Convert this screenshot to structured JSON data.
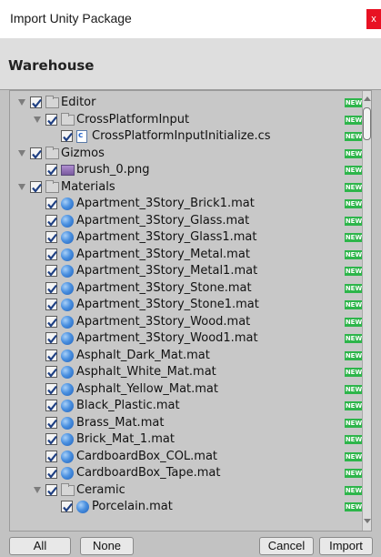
{
  "window": {
    "title": "Import Unity Package",
    "close_glyph": "x"
  },
  "package": {
    "name": "Warehouse"
  },
  "tree": {
    "badge_label": "NEW",
    "items": [
      {
        "label": "Editor",
        "type": "folder",
        "depth": 0,
        "expanded": true,
        "checked": true
      },
      {
        "label": "CrossPlatformInput",
        "type": "folder",
        "depth": 1,
        "expanded": true,
        "checked": true
      },
      {
        "label": "CrossPlatformInputInitialize.cs",
        "type": "script",
        "depth": 2,
        "checked": true
      },
      {
        "label": "Gizmos",
        "type": "folder",
        "depth": 0,
        "expanded": true,
        "checked": true
      },
      {
        "label": "brush_0.png",
        "type": "image",
        "depth": 1,
        "checked": true
      },
      {
        "label": "Materials",
        "type": "folder",
        "depth": 0,
        "expanded": true,
        "checked": true
      },
      {
        "label": "Apartment_3Story_Brick1.mat",
        "type": "material",
        "depth": 1,
        "checked": true
      },
      {
        "label": "Apartment_3Story_Glass.mat",
        "type": "material",
        "depth": 1,
        "checked": true
      },
      {
        "label": "Apartment_3Story_Glass1.mat",
        "type": "material",
        "depth": 1,
        "checked": true
      },
      {
        "label": "Apartment_3Story_Metal.mat",
        "type": "material",
        "depth": 1,
        "checked": true
      },
      {
        "label": "Apartment_3Story_Metal1.mat",
        "type": "material",
        "depth": 1,
        "checked": true
      },
      {
        "label": "Apartment_3Story_Stone.mat",
        "type": "material",
        "depth": 1,
        "checked": true
      },
      {
        "label": "Apartment_3Story_Stone1.mat",
        "type": "material",
        "depth": 1,
        "checked": true
      },
      {
        "label": "Apartment_3Story_Wood.mat",
        "type": "material",
        "depth": 1,
        "checked": true
      },
      {
        "label": "Apartment_3Story_Wood1.mat",
        "type": "material",
        "depth": 1,
        "checked": true
      },
      {
        "label": "Asphalt_Dark_Mat.mat",
        "type": "material",
        "depth": 1,
        "checked": true
      },
      {
        "label": "Asphalt_White_Mat.mat",
        "type": "material",
        "depth": 1,
        "checked": true
      },
      {
        "label": "Asphalt_Yellow_Mat.mat",
        "type": "material",
        "depth": 1,
        "checked": true
      },
      {
        "label": "Black_Plastic.mat",
        "type": "material",
        "depth": 1,
        "checked": true
      },
      {
        "label": "Brass_Mat.mat",
        "type": "material",
        "depth": 1,
        "checked": true
      },
      {
        "label": "Brick_Mat_1.mat",
        "type": "material",
        "depth": 1,
        "checked": true
      },
      {
        "label": "CardboardBox_COL.mat",
        "type": "material",
        "depth": 1,
        "checked": true
      },
      {
        "label": "CardboardBox_Tape.mat",
        "type": "material",
        "depth": 1,
        "checked": true
      },
      {
        "label": "Ceramic",
        "type": "folder",
        "depth": 1,
        "expanded": true,
        "checked": true
      },
      {
        "label": "Porcelain.mat",
        "type": "material",
        "depth": 2,
        "checked": true
      }
    ]
  },
  "footer": {
    "all_label": "All",
    "none_label": "None",
    "cancel_label": "Cancel",
    "import_label": "Import"
  },
  "colors": {
    "badge": "#2db54a",
    "close": "#e81123",
    "background": "#c2c2c2"
  }
}
